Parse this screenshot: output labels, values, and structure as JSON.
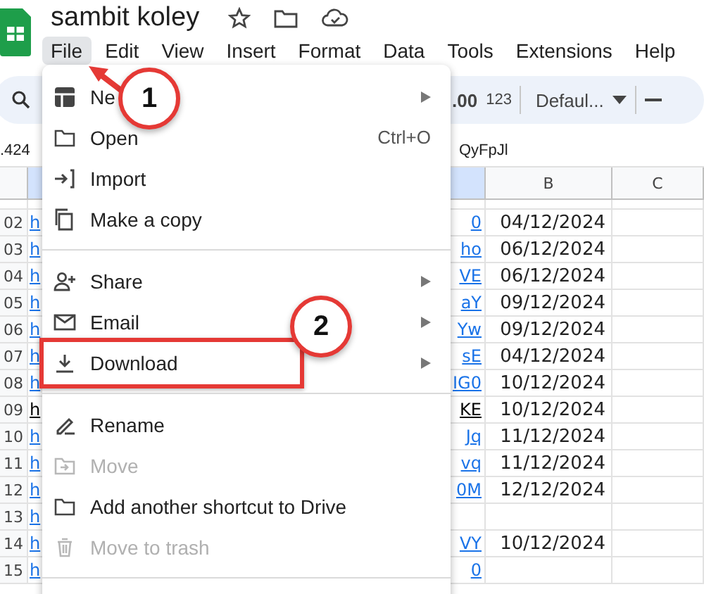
{
  "document": {
    "title": "sambit koley"
  },
  "menu_bar": [
    {
      "label": "File",
      "selected": true
    },
    {
      "label": "Edit",
      "selected": false
    },
    {
      "label": "View",
      "selected": false
    },
    {
      "label": "Insert",
      "selected": false
    },
    {
      "label": "Format",
      "selected": false
    },
    {
      "label": "Data",
      "selected": false
    },
    {
      "label": "Tools",
      "selected": false
    },
    {
      "label": "Extensions",
      "selected": false
    },
    {
      "label": "Help",
      "selected": false
    }
  ],
  "toolbar": {
    "decimal": ".00",
    "number_format": "123",
    "font": "Defaul..."
  },
  "formula_bar": {
    "cell_reference": ".424",
    "content": "QyFpJl"
  },
  "sheet": {
    "columns": [
      "B",
      "C"
    ],
    "rows": [
      {
        "number": "02",
        "kind": "link",
        "a_start": "h",
        "a_end": "0",
        "b": "04/12/2024"
      },
      {
        "number": "03",
        "kind": "link",
        "a_start": "h",
        "a_end": "ho",
        "b": "06/12/2024"
      },
      {
        "number": "04",
        "kind": "link",
        "a_start": "h",
        "a_end": "VE",
        "b": "06/12/2024"
      },
      {
        "number": "05",
        "kind": "link",
        "a_start": "h",
        "a_end": "aY",
        "b": "09/12/2024"
      },
      {
        "number": "06",
        "kind": "link",
        "a_start": "h",
        "a_end": "Yw",
        "b": "09/12/2024"
      },
      {
        "number": "07",
        "kind": "link",
        "a_start": "h",
        "a_end": "sE",
        "b": "04/12/2024"
      },
      {
        "number": "08",
        "kind": "link",
        "a_start": "h",
        "a_end": "IG0",
        "b": "10/12/2024"
      },
      {
        "number": "09",
        "kind": "text",
        "a_start": "h",
        "a_end": "KE",
        "b": "10/12/2024"
      },
      {
        "number": "10",
        "kind": "link",
        "a_start": "h",
        "a_end": "Jq",
        "b": "11/12/2024"
      },
      {
        "number": "11",
        "kind": "link",
        "a_start": "h",
        "a_end": "vq",
        "b": "11/12/2024"
      },
      {
        "number": "12",
        "kind": "link",
        "a_start": "h",
        "a_end": "0M",
        "b": "12/12/2024"
      },
      {
        "number": "13",
        "kind": "link",
        "a_start": "h"
      },
      {
        "number": "14",
        "kind": "link",
        "a_start": "h",
        "a_end": "VY",
        "b": "10/12/2024"
      },
      {
        "number": "15",
        "kind": "link",
        "a_start": "h",
        "a_end": "0"
      }
    ]
  },
  "file_menu": [
    {
      "kind": "item",
      "label": "Ne",
      "submenu": true,
      "disabled": false,
      "highlighted": false
    },
    {
      "kind": "item",
      "label": "Open",
      "shortcut": "Ctrl+O",
      "submenu": false,
      "disabled": false,
      "highlighted": false
    },
    {
      "kind": "item",
      "label": "Import",
      "submenu": false,
      "disabled": false,
      "highlighted": false
    },
    {
      "kind": "item",
      "label": "Make a copy",
      "submenu": false,
      "disabled": false,
      "highlighted": false
    },
    {
      "kind": "divider"
    },
    {
      "kind": "item",
      "label": "Share",
      "submenu": true,
      "disabled": false,
      "highlighted": false
    },
    {
      "kind": "item",
      "label": "Email",
      "submenu": true,
      "disabled": false,
      "highlighted": false
    },
    {
      "kind": "item",
      "label": "Download",
      "submenu": true,
      "disabled": false,
      "highlighted": true
    },
    {
      "kind": "divider"
    },
    {
      "kind": "item",
      "label": "Rename",
      "submenu": false,
      "disabled": false,
      "highlighted": false
    },
    {
      "kind": "item",
      "label": "Move",
      "submenu": false,
      "disabled": true,
      "highlighted": false
    },
    {
      "kind": "item",
      "label": "Add another shortcut to Drive",
      "submenu": false,
      "disabled": false,
      "highlighted": false
    },
    {
      "kind": "item",
      "label": "Move to trash",
      "submenu": false,
      "disabled": true,
      "highlighted": false
    },
    {
      "kind": "divider"
    }
  ],
  "callouts": [
    {
      "number": "1"
    },
    {
      "number": "2"
    }
  ]
}
